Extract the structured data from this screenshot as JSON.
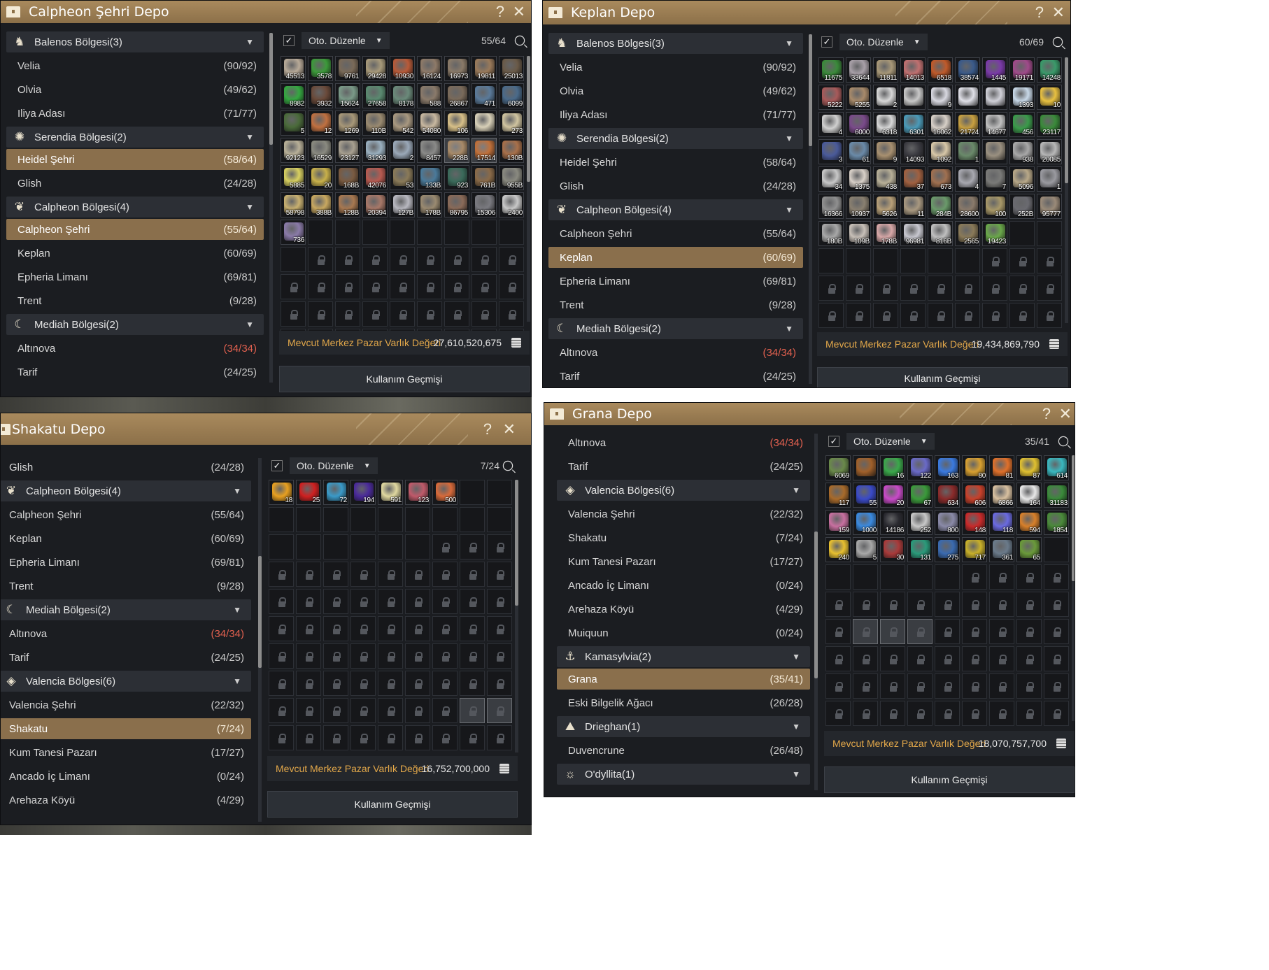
{
  "common": {
    "auto_sort_label": "Oto. Düzenle",
    "value_label": "Mevcut Merkez Pazar Varlık Değeri",
    "history_label": "Kullanım Geçmişi",
    "help_glyph": "?",
    "close_glyph": "✕"
  },
  "w1": {
    "title": "Calpheon Şehri Depo",
    "capacity": "55/64",
    "value": "27,610,520,675",
    "list": [
      {
        "type": "region",
        "label": "Balenos Bölgesi(3)",
        "icon": "horse-icon"
      },
      {
        "type": "town",
        "label": "Velia",
        "count": "(90/92)"
      },
      {
        "type": "town",
        "label": "Olvia",
        "count": "(49/62)"
      },
      {
        "type": "town",
        "label": "Iliya Adası",
        "count": "(71/77)"
      },
      {
        "type": "region",
        "label": "Serendia Bölgesi(2)",
        "icon": "flame-icon"
      },
      {
        "type": "town",
        "label": "Heidel Şehri",
        "count": "(58/64)",
        "sel": true
      },
      {
        "type": "town",
        "label": "Glish",
        "count": "(24/28)"
      },
      {
        "type": "region",
        "label": "Calpheon Bölgesi(4)",
        "icon": "wings-icon"
      },
      {
        "type": "town",
        "label": "Calpheon Şehri",
        "count": "(55/64)",
        "sel": true
      },
      {
        "type": "town",
        "label": "Keplan",
        "count": "(60/69)"
      },
      {
        "type": "town",
        "label": "Epheria Limanı",
        "count": "(69/81)"
      },
      {
        "type": "town",
        "label": "Trent",
        "count": "(9/28)"
      },
      {
        "type": "region",
        "label": "Mediah Bölgesi(2)",
        "icon": "moon-icon"
      },
      {
        "type": "town",
        "label": "Altınova",
        "count": "(34/34)",
        "red": true
      },
      {
        "type": "town",
        "label": "Tarif",
        "count": "(24/25)"
      }
    ],
    "items": [
      "45513",
      "3578",
      "9761",
      "29428",
      "10930",
      "16124",
      "16973",
      "19811",
      "25013",
      "8982",
      "3932",
      "15624",
      "27658",
      "8178",
      "588",
      "26867",
      "471",
      "6099",
      "5",
      "12",
      "1269",
      "110B",
      "542",
      "54080",
      "106",
      "",
      "273",
      "92123",
      "16529",
      "23127",
      "31293",
      "2",
      "8457",
      "228B",
      "17514",
      "130B",
      "5885",
      "20",
      "168B",
      "42076",
      "53",
      "133B",
      "923",
      "761B",
      "955B",
      "58798",
      "388B",
      "128B",
      "20394",
      "127B",
      "178B",
      "86795",
      "15306",
      "2400",
      "736"
    ],
    "colors": [
      "#b8aa98",
      "#3c9a3a",
      "#7a6a58",
      "#a89a7a",
      "#b85a38",
      "#8e7a68",
      "#8a7a68",
      "#9a7a5a",
      "#6a5a48",
      "#34a840",
      "#6a4a3a",
      "#7a9a88",
      "#5a8a70",
      "#6a8a7a",
      "#8a7a6a",
      "#7a6a5a",
      "#5a7a9a",
      "#4a6a8a",
      "#4a6a3a",
      "#c07040",
      "#a89878",
      "#9a8a70",
      "#a89880",
      "#c8b8a0",
      "#d8c088",
      "#d8d0b8",
      "#d0c4a0",
      "#b8b098",
      "#8a8a80",
      "#a8a090",
      "#9ab0c0",
      "#9aa8b8",
      "#8a8a88",
      "#a88a68",
      "#c0703a",
      "#a8704a",
      "#d8d060",
      "#c8b04a",
      "#7a5a40",
      "#b85a50",
      "#8a7a58",
      "#4a7a9a",
      "#3a6a5a",
      "#8a6a48",
      "#8a8a80",
      "#c8b070",
      "#c8a860",
      "#a87850",
      "#a87868",
      "#b8b8c0",
      "#9a8a70",
      "#8a6a58",
      "#7a7a80",
      "#c8c8c8",
      "#8a7aa8"
    ],
    "total_slots": 99,
    "hl_slots": [
      33,
      34
    ]
  },
  "w2": {
    "title": "Keplan Depo",
    "capacity": "60/69",
    "value": "19,434,869,790",
    "list": [
      {
        "type": "region",
        "label": "Balenos Bölgesi(3)",
        "icon": "horse-icon"
      },
      {
        "type": "town",
        "label": "Velia",
        "count": "(90/92)"
      },
      {
        "type": "town",
        "label": "Olvia",
        "count": "(49/62)"
      },
      {
        "type": "town",
        "label": "Iliya Adası",
        "count": "(71/77)"
      },
      {
        "type": "region",
        "label": "Serendia Bölgesi(2)",
        "icon": "flame-icon"
      },
      {
        "type": "town",
        "label": "Heidel Şehri",
        "count": "(58/64)"
      },
      {
        "type": "town",
        "label": "Glish",
        "count": "(24/28)"
      },
      {
        "type": "region",
        "label": "Calpheon Bölgesi(4)",
        "icon": "wings-icon"
      },
      {
        "type": "town",
        "label": "Calpheon Şehri",
        "count": "(55/64)"
      },
      {
        "type": "town",
        "label": "Keplan",
        "count": "(60/69)",
        "sel": true
      },
      {
        "type": "town",
        "label": "Epheria Limanı",
        "count": "(69/81)"
      },
      {
        "type": "town",
        "label": "Trent",
        "count": "(9/28)"
      },
      {
        "type": "region",
        "label": "Mediah Bölgesi(2)",
        "icon": "moon-icon"
      },
      {
        "type": "town",
        "label": "Altınova",
        "count": "(34/34)",
        "red": true
      },
      {
        "type": "town",
        "label": "Tarif",
        "count": "(24/25)"
      }
    ],
    "items": [
      "11675",
      "33644",
      "11811",
      "14013",
      "6518",
      "38574",
      "1445",
      "19171",
      "14248",
      "5222",
      "5255",
      "2",
      "",
      "9",
      "",
      "",
      "1393",
      "10",
      "4",
      "6000",
      "6318",
      "6301",
      "16062",
      "21724",
      "14677",
      "456",
      "23117",
      "3",
      "61",
      "9",
      "14093",
      "1092",
      "1",
      "",
      "938",
      "20085",
      "34",
      "1375",
      "438",
      "37",
      "673",
      "4",
      "7",
      "5096",
      "1",
      "16366",
      "10937",
      "5626",
      "11",
      "284B",
      "28600",
      "100",
      "252B",
      "95777",
      "180B",
      "109B",
      "178B",
      "96981",
      "816B",
      "2565",
      "19423"
    ],
    "colors": [
      "#3a8a3a",
      "#a8a0a8",
      "#a89878",
      "#c07070",
      "#c05a2a",
      "#3a5a8a",
      "#7a3aa8",
      "#a04a8a",
      "#3a9a6a",
      "#a85a5a",
      "#a88a6a",
      "#d8d8d8",
      "#c8c8c8",
      "#d8d8e0",
      "#e0e0e8",
      "#d0d0d8",
      "#c8d8e8",
      "#e8c040",
      "#d0d0d0",
      "#7a4a8a",
      "#d8d8d8",
      "#4a9ab8",
      "#d8d0c8",
      "#c8a040",
      "#c0c0c0",
      "#3a9a4a",
      "#3a8a3a",
      "#4a5a9a",
      "#6a8aa8",
      "#a89070",
      "#3a3a40",
      "#d8c8a8",
      "#6a8a6a",
      "#9a9080",
      "#a8a8a8",
      "#b8b8b8",
      "#c8c8c8",
      "#d8d0c8",
      "#b8b098",
      "#a06040",
      "#a07050",
      "#a8a8b0",
      "#7a7a78",
      "#b8a888",
      "#9a9aa0",
      "#909090",
      "#8a8070",
      "#b8a078",
      "#a89880",
      "#6a9a6a",
      "#8a7a6a",
      "#a89868",
      "#6a6a70",
      "#9a8a78",
      "#a8a8a8",
      "#c8c0b8",
      "#d8a8a8",
      "#c8c8d0",
      "#c0c0c0",
      "#8a7a58",
      "#6aa84a"
    ],
    "total_slots": 90,
    "hl_slots": []
  },
  "w3": {
    "title": "Shakatu Depo",
    "capacity": "7/24",
    "value": "16,752,700,000",
    "list": [
      {
        "type": "town",
        "label": "Glish",
        "count": "(24/28)"
      },
      {
        "type": "region",
        "label": "Calpheon Bölgesi(4)",
        "icon": "wings-icon"
      },
      {
        "type": "town",
        "label": "Calpheon Şehri",
        "count": "(55/64)"
      },
      {
        "type": "town",
        "label": "Keplan",
        "count": "(60/69)"
      },
      {
        "type": "town",
        "label": "Epheria Limanı",
        "count": "(69/81)"
      },
      {
        "type": "town",
        "label": "Trent",
        "count": "(9/28)"
      },
      {
        "type": "region",
        "label": "Mediah Bölgesi(2)",
        "icon": "moon-icon"
      },
      {
        "type": "town",
        "label": "Altınova",
        "count": "(34/34)",
        "red": true
      },
      {
        "type": "town",
        "label": "Tarif",
        "count": "(24/25)"
      },
      {
        "type": "region",
        "label": "Valencia Bölgesi(6)",
        "icon": "diamond-icon"
      },
      {
        "type": "town",
        "label": "Valencia Şehri",
        "count": "(22/32)"
      },
      {
        "type": "town",
        "label": "Shakatu",
        "count": "(7/24)",
        "sel": true
      },
      {
        "type": "town",
        "label": "Kum Tanesi Pazarı",
        "count": "(17/27)"
      },
      {
        "type": "town",
        "label": "Ancado İç Limanı",
        "count": "(0/24)"
      },
      {
        "type": "town",
        "label": "Arehaza Köyü",
        "count": "(4/29)"
      }
    ],
    "items": [
      "18",
      "25",
      "72",
      "194",
      "591",
      "123",
      "500"
    ],
    "colors": [
      "#e8a020",
      "#d02020",
      "#3a9ac8",
      "#4a2a9a",
      "#e0d8a0",
      "#c05a6a",
      "#d86a3a"
    ],
    "total_slots": 90,
    "free_slots": 24,
    "hl_slots": [
      79,
      80
    ]
  },
  "w4": {
    "title": "Grana Depo",
    "capacity": "35/41",
    "value": "18,070,757,700",
    "list": [
      {
        "type": "town",
        "label": "Altınova",
        "count": "(34/34)",
        "red": true
      },
      {
        "type": "town",
        "label": "Tarif",
        "count": "(24/25)"
      },
      {
        "type": "region",
        "label": "Valencia Bölgesi(6)",
        "icon": "diamond-icon"
      },
      {
        "type": "town",
        "label": "Valencia Şehri",
        "count": "(22/32)"
      },
      {
        "type": "town",
        "label": "Shakatu",
        "count": "(7/24)"
      },
      {
        "type": "town",
        "label": "Kum Tanesi Pazarı",
        "count": "(17/27)"
      },
      {
        "type": "town",
        "label": "Ancado İç Limanı",
        "count": "(0/24)"
      },
      {
        "type": "town",
        "label": "Arehaza Köyü",
        "count": "(4/29)"
      },
      {
        "type": "town",
        "label": "Muiquun",
        "count": "(0/24)"
      },
      {
        "type": "region",
        "label": "Kamasylvia(2)",
        "icon": "anchor-icon"
      },
      {
        "type": "town",
        "label": "Grana",
        "count": "(35/41)",
        "sel": true
      },
      {
        "type": "town",
        "label": "Eski Bilgelik Ağacı",
        "count": "(26/28)"
      },
      {
        "type": "region",
        "label": "Drieghan(1)",
        "icon": "mountain-icon"
      },
      {
        "type": "town",
        "label": "Duvencrune",
        "count": "(26/48)"
      },
      {
        "type": "region",
        "label": "O'dyllita(1)",
        "icon": "sun-icon"
      }
    ],
    "items": [
      "6069",
      "",
      "16",
      "122",
      "163",
      "80",
      "81",
      "87",
      "614",
      "117",
      "55",
      "20",
      "67",
      "634",
      "606",
      "6866",
      "164",
      "31183",
      "159",
      "1000",
      "14186",
      "252",
      "800",
      "148",
      "118",
      "594",
      "1854",
      "240",
      "5",
      "30",
      "131",
      "275",
      "717",
      "361",
      "65"
    ],
    "colors": [
      "#6a8a4a",
      "#a0602a",
      "#3aa84a",
      "#6a6ac8",
      "#3a7ae0",
      "#d8a030",
      "#e0702a",
      "#e0c030",
      "#3ab8c0",
      "#a86a2a",
      "#3a4ac8",
      "#c84ac8",
      "#3a9a3a",
      "#8a2a2a",
      "#c8402a",
      "#d8c0a0",
      "#e8e8e8",
      "#3a8a3a",
      "#c870a0",
      "#3a8ae0",
      "#2a2a30",
      "#c8c8c8",
      "#8a8aa8",
      "#c82a2a",
      "#6a6ae0",
      "#d8802a",
      "#4a8a3a",
      "#e8c030",
      "#a8a8a8",
      "#a83a3a",
      "#2a9a7a",
      "#3a6ab0",
      "#c8b02a",
      "#6a7a8a",
      "#6a9a3a"
    ],
    "total_slots": 90,
    "free_slots": 41,
    "hl_slots": [
      55,
      56,
      57
    ]
  }
}
